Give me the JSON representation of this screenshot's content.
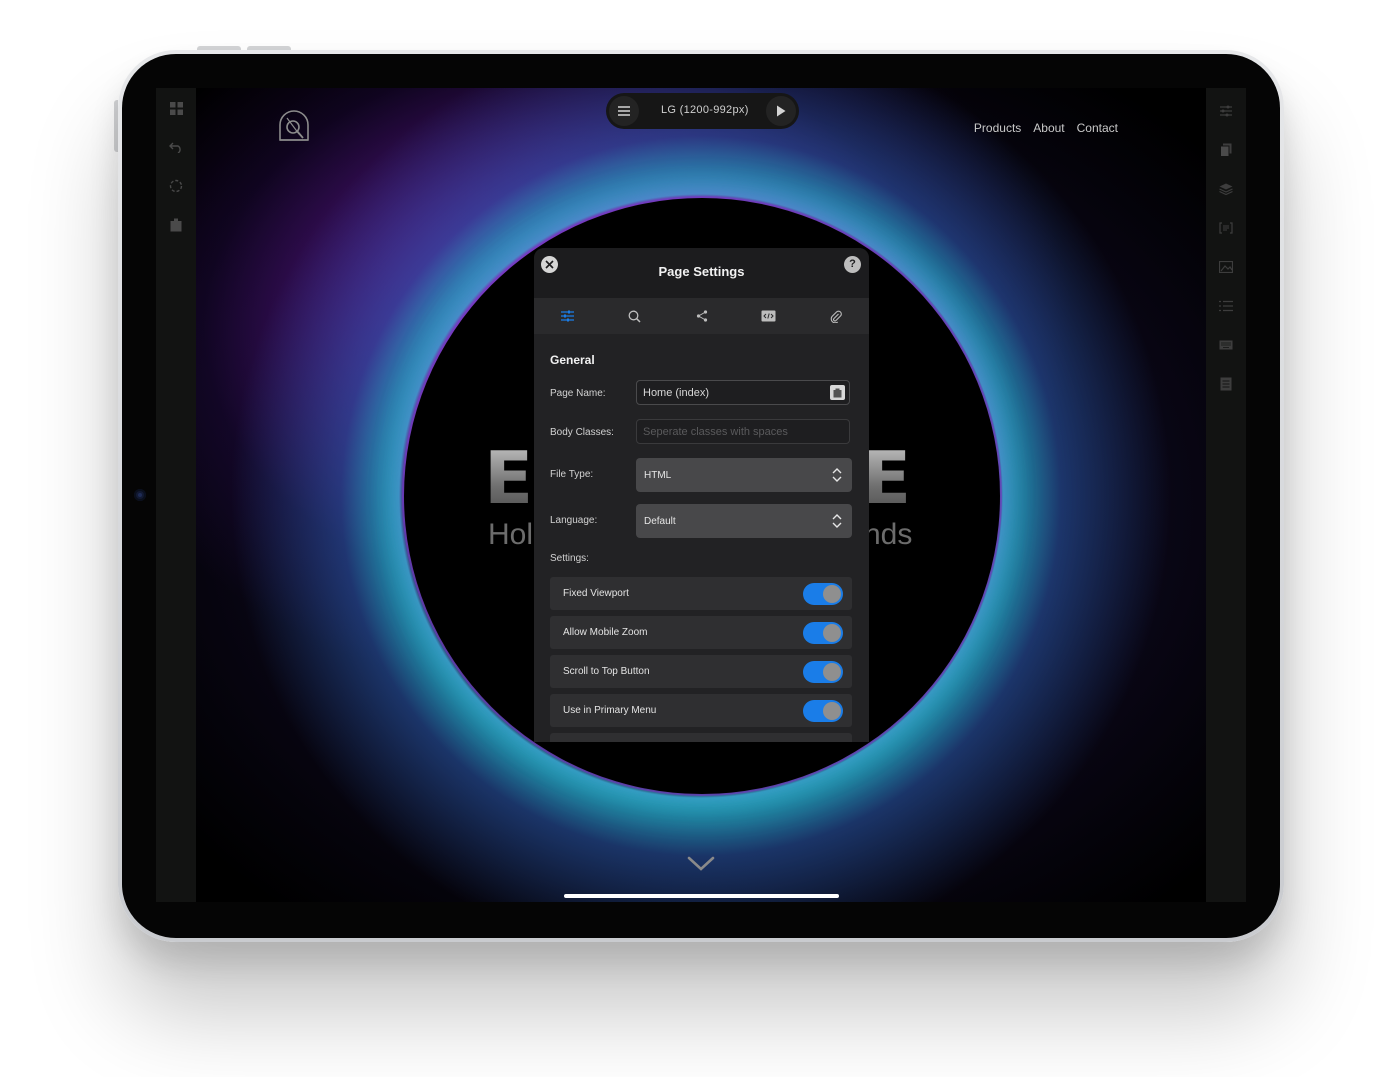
{
  "toolbar": {
    "breakpoint_label": "LG (1200-992px)"
  },
  "nav": {
    "items": [
      "Products",
      "About",
      "Contact"
    ]
  },
  "hero": {
    "left_letter": "E",
    "right_letter": "E",
    "sub_left": "Hol",
    "sub_right": "nds"
  },
  "modal": {
    "title": "Page Settings",
    "help_label": "?",
    "tabs": [
      "general-tab",
      "seo-tab",
      "social-tab",
      "code-tab",
      "attachments-tab"
    ],
    "section_title": "General",
    "page_name": {
      "label": "Page Name:",
      "value": "Home (index)"
    },
    "body_classes": {
      "label": "Body Classes:",
      "placeholder": "Seperate classes with spaces"
    },
    "file_type": {
      "label": "File Type:",
      "value": "HTML"
    },
    "language": {
      "label": "Language:",
      "value": "Default"
    },
    "settings_label": "Settings:",
    "toggles": [
      {
        "label": "Fixed Viewport",
        "on": true
      },
      {
        "label": "Allow Mobile Zoom",
        "on": true
      },
      {
        "label": "Scroll to Top Button",
        "on": true
      },
      {
        "label": "Use in Primary Menu",
        "on": true
      }
    ]
  },
  "colors": {
    "accent": "#1a7de8",
    "modal_bg": "#1c1c1e",
    "rail_bg": "#121312"
  }
}
